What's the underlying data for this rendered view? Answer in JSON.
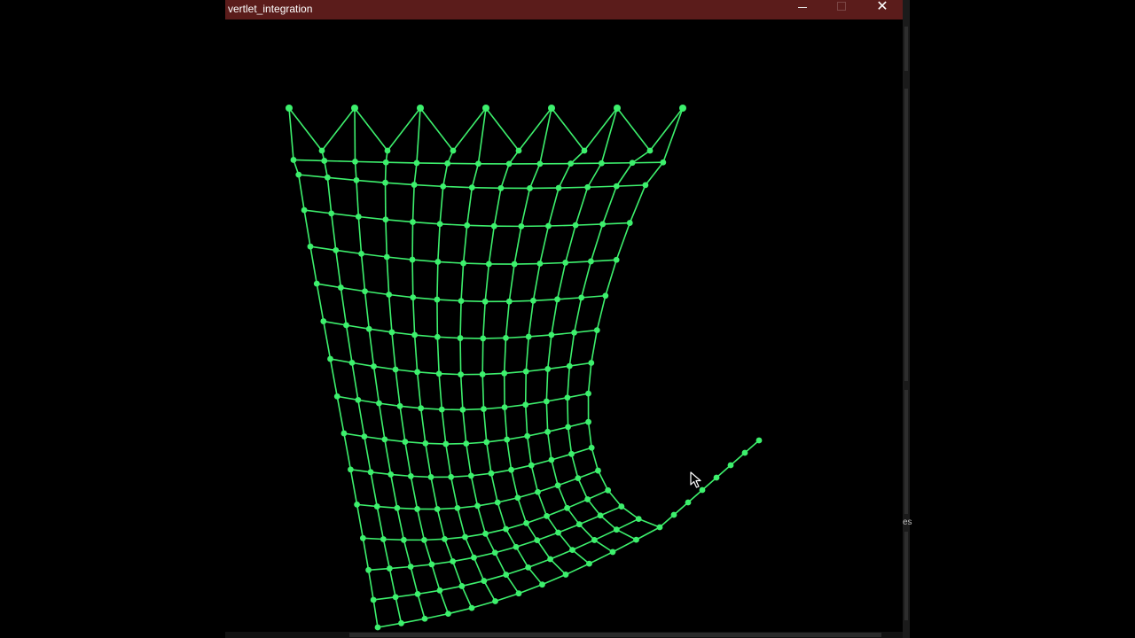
{
  "window": {
    "title": "vertlet_integration",
    "buttons": [
      {
        "name": "minimize-button",
        "icon": "minimize-icon"
      },
      {
        "name": "maximize-button",
        "icon": "maximize-icon"
      },
      {
        "name": "close-button",
        "icon": "close-icon"
      }
    ]
  },
  "background": {
    "partial_text": "es"
  },
  "scene": {
    "background_color": "#000000",
    "point_color": "#3df06d",
    "stick_color": "#3df06d",
    "cloth": {
      "columns": 13,
      "rows": 16,
      "pinned_points": 7
    }
  },
  "cursor": {
    "icon": "mouse-pointer-icon"
  },
  "colors": {
    "titlebar": "#5b1c1b",
    "title_text": "#ffffff",
    "accent_green": "#3df06d"
  }
}
